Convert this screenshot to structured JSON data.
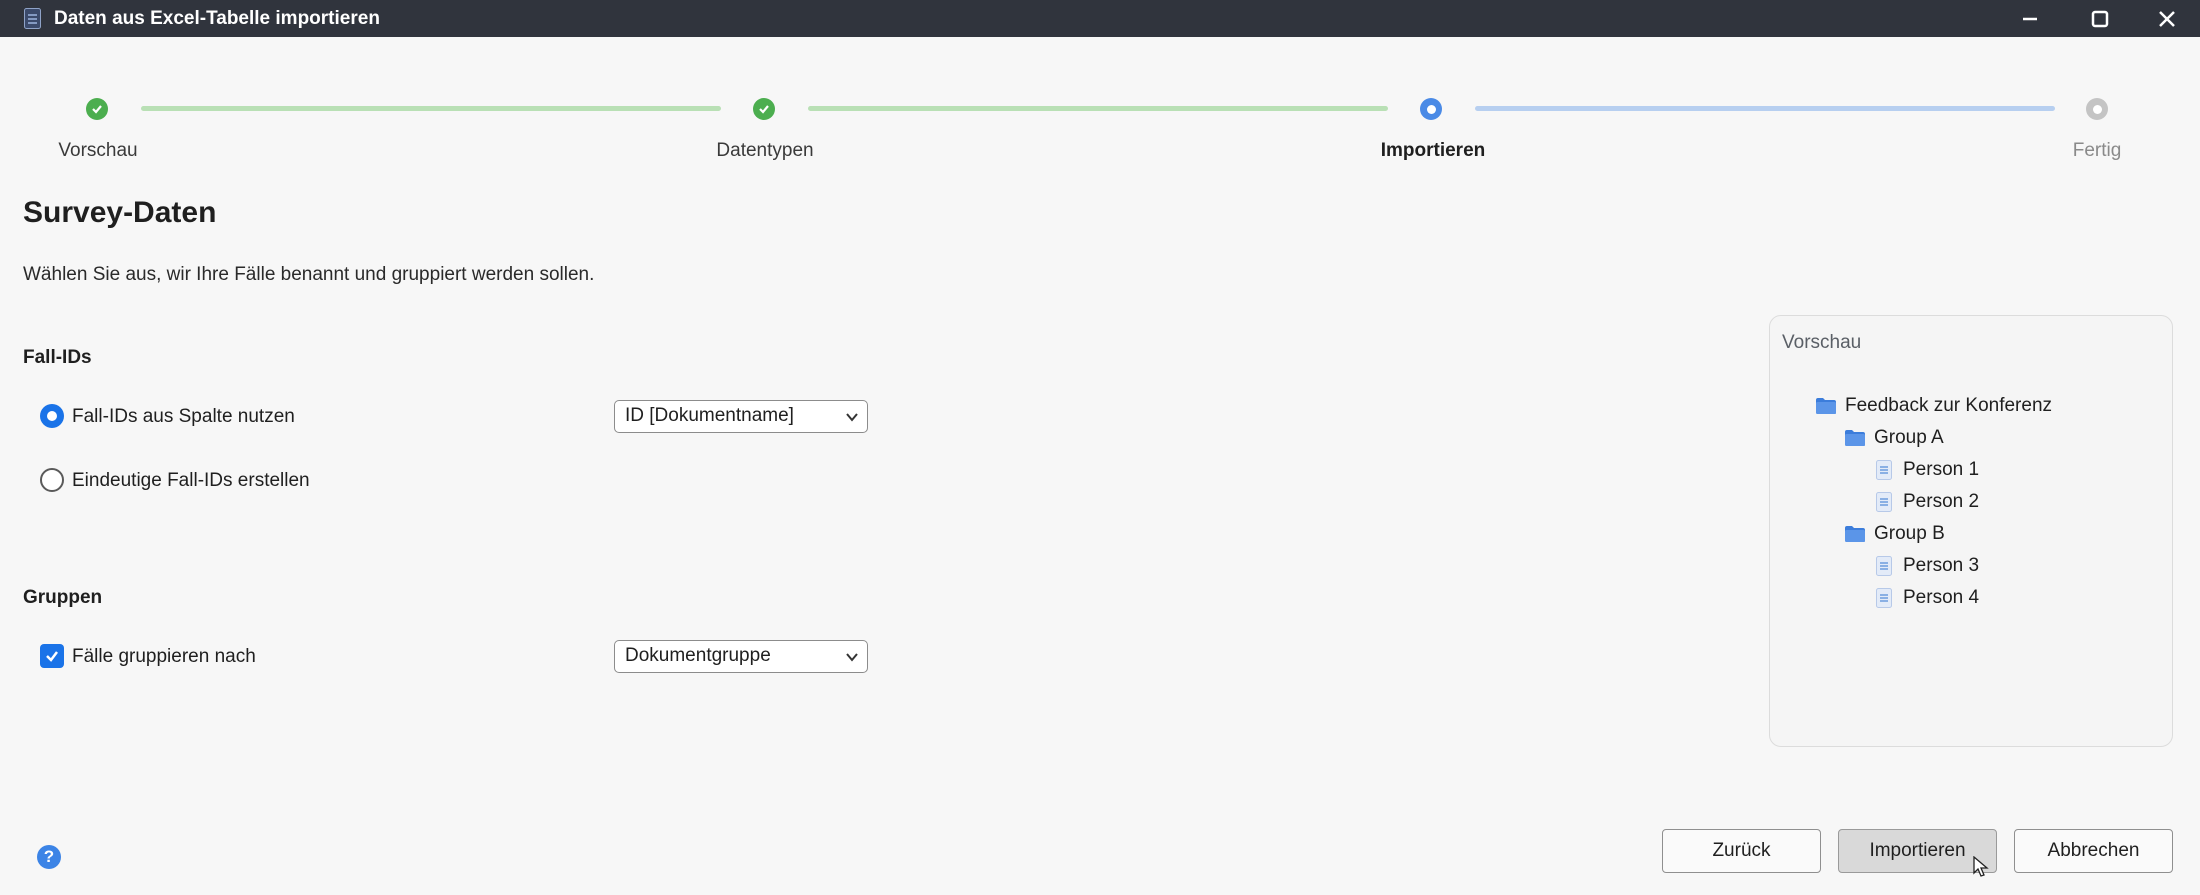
{
  "window": {
    "title": "Daten aus Excel-Tabelle importieren",
    "icon": "document-list-icon"
  },
  "stepper": {
    "steps": [
      {
        "label": "Vorschau",
        "state": "done"
      },
      {
        "label": "Datentypen",
        "state": "done"
      },
      {
        "label": "Importieren",
        "state": "active"
      },
      {
        "label": "Fertig",
        "state": "pending"
      }
    ],
    "colors": {
      "done": "#4cae4f",
      "active": "#4a8ae6",
      "pending": "#c4c4c4",
      "done_line": "#b9e0b5",
      "active_line": "#b7cff0"
    }
  },
  "page": {
    "heading": "Survey-Daten",
    "description": "Wählen Sie aus, wir Ihre Fälle benannt und gruppiert werden sollen."
  },
  "case_ids": {
    "section_label": "Fall-IDs",
    "option_column": "Fall-IDs aus Spalte nutzen",
    "option_column_selected": true,
    "column_select_value": "ID [Dokumentname]",
    "option_unique": "Eindeutige Fall-IDs erstellen",
    "option_unique_selected": false
  },
  "groups": {
    "section_label": "Gruppen",
    "checkbox_label": "Fälle gruppieren nach",
    "checked": true,
    "select_value": "Dokumentgruppe"
  },
  "preview": {
    "title": "Vorschau",
    "root": "Feedback zur Konferenz",
    "groups": [
      {
        "name": "Group A",
        "items": [
          "Person 1",
          "Person 2"
        ]
      },
      {
        "name": "Group B",
        "items": [
          "Person 3",
          "Person 4"
        ]
      }
    ]
  },
  "footer": {
    "help_label": "?",
    "back_label": "Zurück",
    "import_label": "Importieren",
    "cancel_label": "Abbrechen"
  },
  "accent_color": "#1a73e8"
}
